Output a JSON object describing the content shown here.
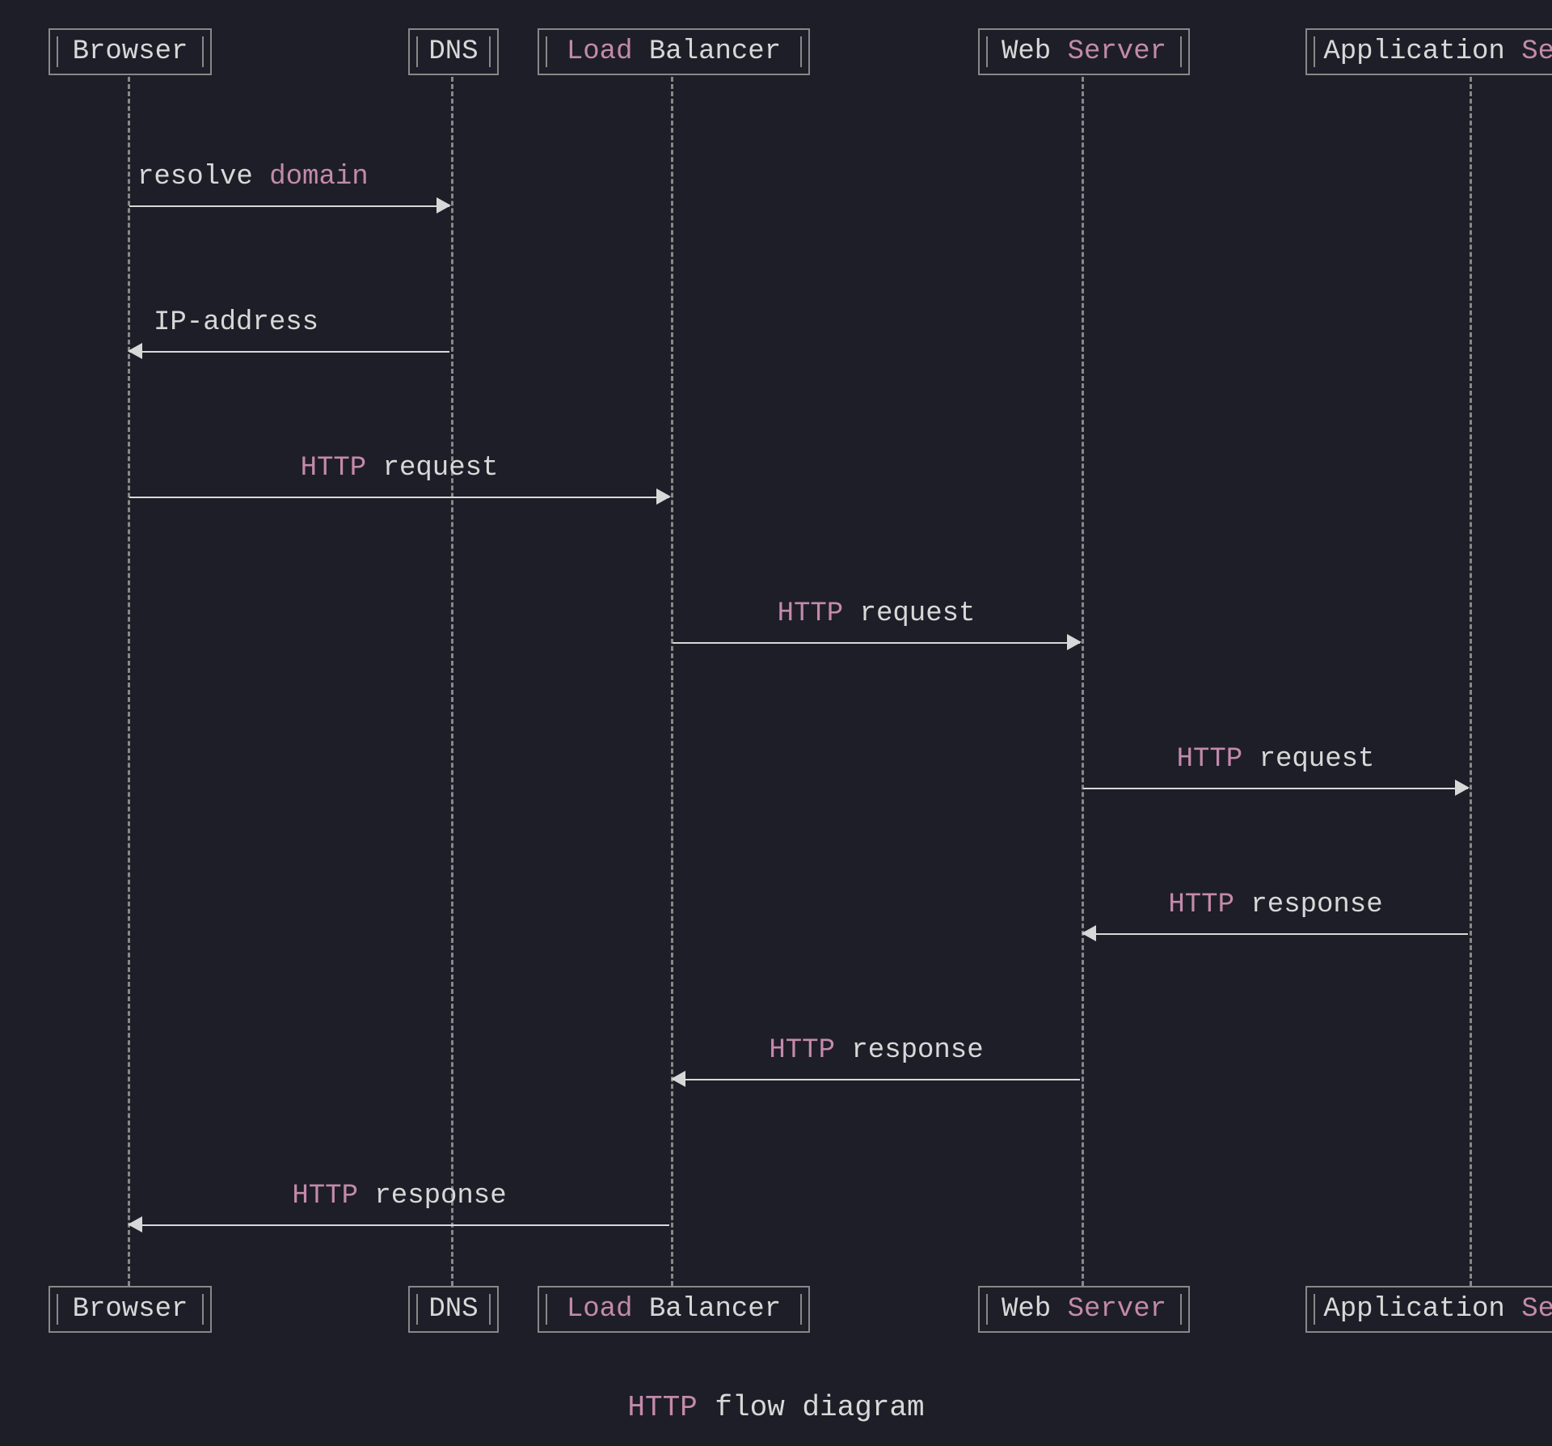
{
  "participants": {
    "browser": {
      "word1": "Browser",
      "word2": ""
    },
    "dns": {
      "word1": "DNS",
      "word2": ""
    },
    "lb": {
      "word1": "Load",
      "word2": "Balancer"
    },
    "web": {
      "word1": "Web",
      "word2": "Server"
    },
    "app": {
      "word1": "Application",
      "word2": "Server"
    }
  },
  "messages": {
    "m1": {
      "w1": "resolve",
      "w2": "domain"
    },
    "m2": {
      "w1": "IP-address",
      "w2": ""
    },
    "m3": {
      "w1": "HTTP",
      "w2": "request"
    },
    "m4": {
      "w1": "HTTP",
      "w2": "request"
    },
    "m5": {
      "w1": "HTTP",
      "w2": "request"
    },
    "m6": {
      "w1": "HTTP",
      "w2": "response"
    },
    "m7": {
      "w1": "HTTP",
      "w2": "response"
    },
    "m8": {
      "w1": "HTTP",
      "w2": "response"
    }
  },
  "caption": {
    "w1": "HTTP",
    "w2": "flow diagram"
  },
  "colors": {
    "background": "#1e1e28",
    "text": "#d8d8d8",
    "highlight": "#c38aab",
    "border": "#888888"
  }
}
